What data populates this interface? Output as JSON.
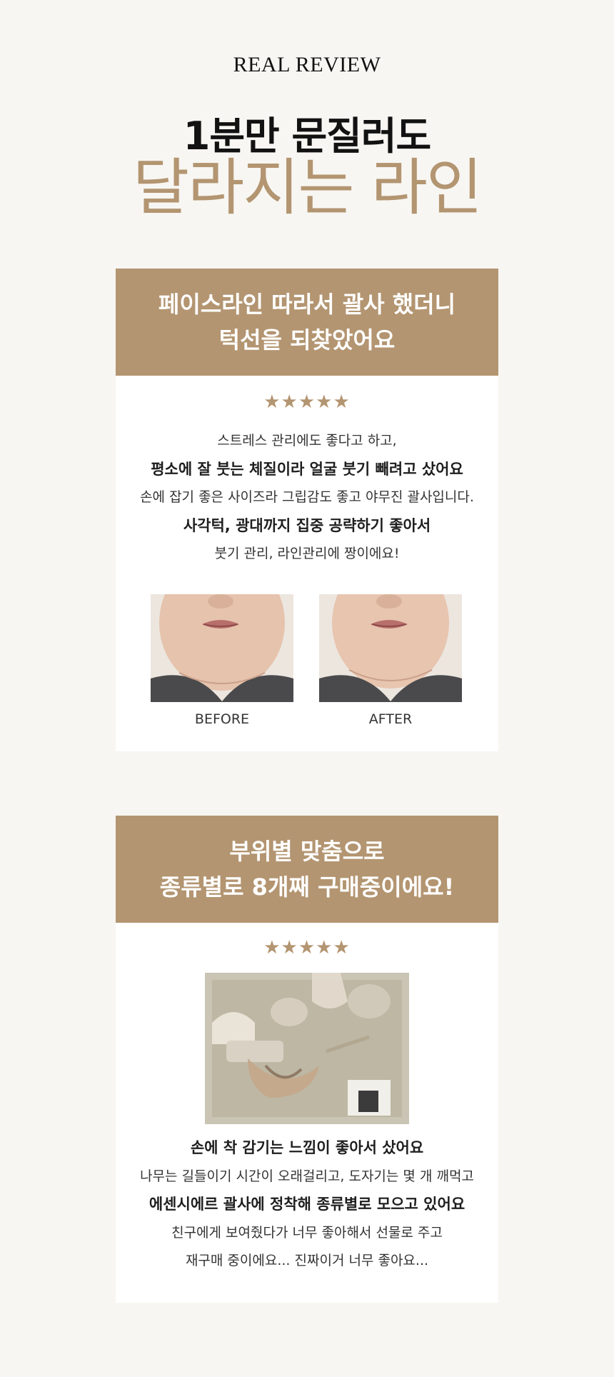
{
  "header": {
    "eyebrow": "REAL REVIEW",
    "headline_line1": "1분만 문질러도",
    "headline_line2": "달라지는 라인"
  },
  "colors": {
    "accent": "#b39571",
    "background": "#f7f6f2",
    "card": "#ffffff"
  },
  "reviews": [
    {
      "title_line1": "페이스라인 따라서 괄사 했더니",
      "title_line2": "턱선을 되찾았어요",
      "stars": "★★★★★",
      "lines": [
        "스트레스 관리에도 좋다고 하고,",
        "평소에 잘 붓는 체질이라 얼굴 붓기 빼려고 샀어요",
        "손에 잡기 좋은 사이즈라 그립감도 좋고 야무진 괄사입니다.",
        "사각턱, 광대까지 집중 공략하기 좋아서",
        "붓기 관리, 라인관리에 짱이에요!"
      ],
      "before_label": "BEFORE",
      "after_label": "AFTER"
    },
    {
      "title_line1": "부위별 맞춤으로",
      "title_line2": "종류별로 8개째 구매중이에요!",
      "stars": "★★★★★",
      "lines": [
        "손에 착 감기는 느낌이 좋아서 샀어요",
        "나무는 길들이기 시간이 오래걸리고, 도자기는 몇 개 깨먹고",
        "에센시에르 괄사에 정착해 종류별로 모으고 있어요",
        "친구에게 보여줬다가 너무 좋아해서 선물로 주고",
        "재구매 중이에요... 진짜이거 너무 좋아요..."
      ]
    }
  ]
}
